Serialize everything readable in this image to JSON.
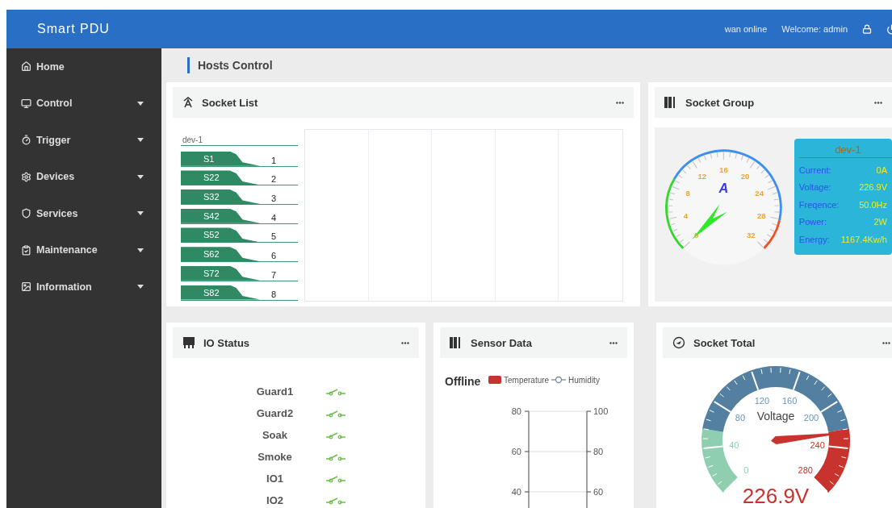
{
  "header": {
    "title": "Smart PDU",
    "status": "wan online",
    "welcome": "Welcome: admin"
  },
  "sidebar": {
    "items": [
      {
        "label": "Home",
        "expandable": false
      },
      {
        "label": "Control",
        "expandable": true
      },
      {
        "label": "Trigger",
        "expandable": true
      },
      {
        "label": "Devices",
        "expandable": true
      },
      {
        "label": "Services",
        "expandable": true
      },
      {
        "label": "Maintenance",
        "expandable": true
      },
      {
        "label": "Information",
        "expandable": true
      }
    ]
  },
  "breadcrumb": "Hosts Control",
  "socket_list": {
    "title": "Socket List",
    "device": "dev-1",
    "sockets": [
      {
        "label": "S1",
        "number": "1"
      },
      {
        "label": "S22",
        "number": "2"
      },
      {
        "label": "S32",
        "number": "3"
      },
      {
        "label": "S42",
        "number": "4"
      },
      {
        "label": "S52",
        "number": "5"
      },
      {
        "label": "S62",
        "number": "6"
      },
      {
        "label": "S72",
        "number": "7"
      },
      {
        "label": "S82",
        "number": "8"
      }
    ]
  },
  "socket_group": {
    "title": "Socket Group",
    "gauge": {
      "unit": "A",
      "labels": [
        "0",
        "4",
        "8",
        "12",
        "16",
        "20",
        "24",
        "28",
        "32"
      ]
    },
    "info": {
      "device": "dev-1",
      "rows": [
        {
          "label": "Current:",
          "value": "0A"
        },
        {
          "label": "Voltage:",
          "value": "226.9V"
        },
        {
          "label": "Freqence:",
          "value": "50.0Hz"
        },
        {
          "label": "Power:",
          "value": "2W"
        },
        {
          "label": "Energy:",
          "value": "1167.4Kw/h"
        }
      ]
    }
  },
  "io_status": {
    "title": "IO Status",
    "items": [
      {
        "name": "Guard1"
      },
      {
        "name": "Guard2"
      },
      {
        "name": "Soak"
      },
      {
        "name": "Smoke"
      },
      {
        "name": "IO1"
      },
      {
        "name": "IO2"
      }
    ]
  },
  "sensor_data": {
    "title": "Sensor Data",
    "chart": {
      "status": "Offline",
      "legend": [
        {
          "name": "Temperature",
          "kind": "bar",
          "color": "#c23531"
        },
        {
          "name": "Humidity",
          "kind": "line",
          "color": "#7a8a99"
        }
      ],
      "left_ticks": [
        "80",
        "60",
        "40"
      ],
      "right_ticks": [
        "100",
        "80",
        "60"
      ]
    }
  },
  "socket_total": {
    "title": "Socket Total",
    "gauge": {
      "title": "Voltage",
      "labels": [
        "0",
        "40",
        "80",
        "120",
        "160",
        "200",
        "240",
        "280"
      ],
      "value": "226.9V",
      "level": 0.81
    }
  }
}
